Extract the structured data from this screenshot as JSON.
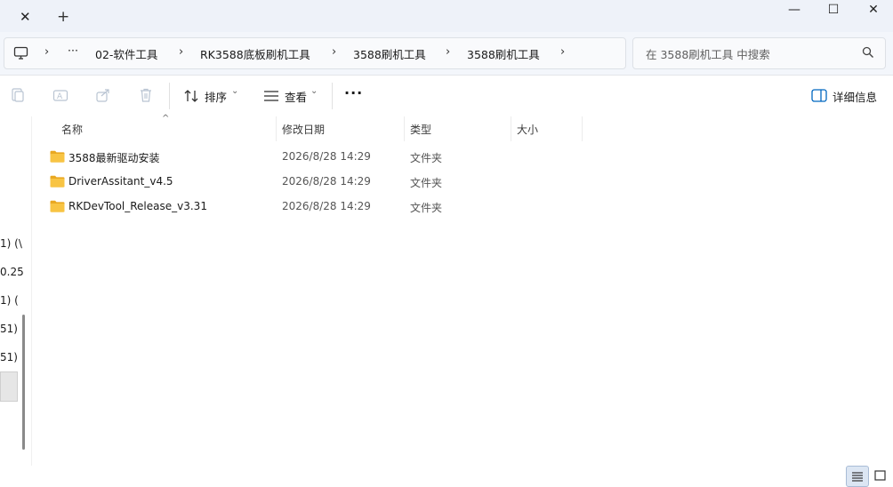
{
  "window": {
    "tab_close_glyph": "✕",
    "new_tab_glyph": "+",
    "minimize_glyph": "—",
    "maximize_glyph": "☐",
    "close_glyph": "✕"
  },
  "address": {
    "overflow_glyph": "···",
    "separator_glyph": "›",
    "breadcrumbs": [
      "02-软件工具",
      "RK3588底板刷机工具",
      "3588刷机工具",
      "3588刷机工具"
    ]
  },
  "search": {
    "placeholder": "在 3588刷机工具 中搜索"
  },
  "toolbar": {
    "sort_label": "排序",
    "view_label": "查看",
    "more_glyph": "···",
    "details_label": "详细信息",
    "dropdown_glyph": "⌄"
  },
  "nav_pane": {
    "visible_fragments": [
      "1) (\\",
      "0.25",
      "1) (",
      "51)",
      "51)"
    ]
  },
  "columns": {
    "name": "名称",
    "date": "修改日期",
    "type": "类型",
    "size": "大小"
  },
  "files": [
    {
      "name": "3588最新驱动安装",
      "date": "2026/8/28 14:29",
      "type": "文件夹",
      "icon": "folder-icon"
    },
    {
      "name": "DriverAssitant_v4.5",
      "date": "2026/8/28 14:29",
      "type": "文件夹",
      "icon": "folder-icon"
    },
    {
      "name": "RKDevTool_Release_v3.31",
      "date": "2026/8/28 14:29",
      "type": "文件夹",
      "icon": "folder-icon"
    }
  ],
  "colors": {
    "folder_yellow": "#f8c443",
    "accent_blue": "#0067c0"
  }
}
